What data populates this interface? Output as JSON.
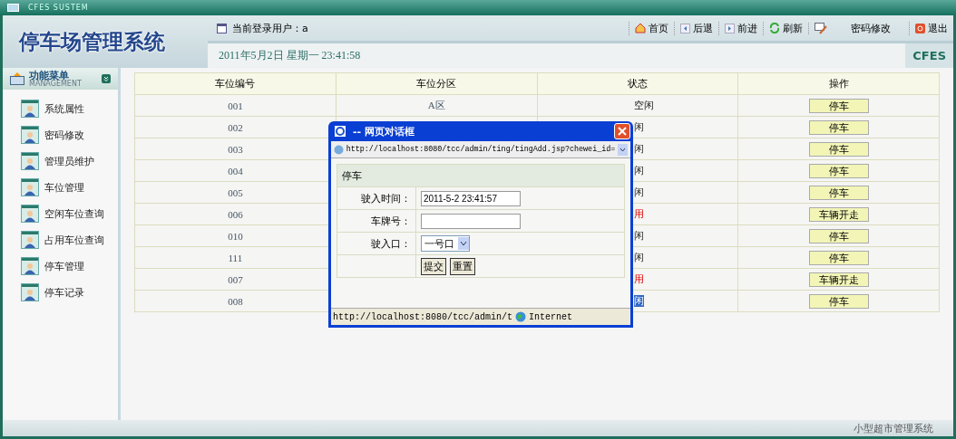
{
  "window": {
    "title": "CFES SUSTEM"
  },
  "header": {
    "app_title": "停车场管理系统",
    "user_label": "当前登录用户：a",
    "datetime": "2011年5月2日  星期一  23:41:58",
    "brand": "CFES",
    "toolbar": [
      {
        "kind": "home",
        "label": "首页"
      },
      {
        "kind": "back",
        "label": "后退"
      },
      {
        "kind": "forward",
        "label": "前进"
      },
      {
        "kind": "refresh",
        "label": "刷新"
      },
      {
        "kind": "edit"
      },
      {
        "kind": "text",
        "label": "密码修改"
      },
      {
        "kind": "exit",
        "label": "退出"
      }
    ]
  },
  "sidebar": {
    "title": "功能菜单",
    "subtitle": "MANAGEMENT",
    "items": [
      "系统属性",
      "密码修改",
      "管理员维护",
      "车位管理",
      "空闲车位查询",
      "占用车位查询",
      "停车管理",
      "停车记录"
    ]
  },
  "table": {
    "columns": [
      "车位编号",
      "车位分区",
      "状态",
      "操作"
    ],
    "rows": [
      {
        "number": "001",
        "zone": "A区",
        "status": "空闲",
        "in_use": false,
        "selected": false,
        "action": "停车"
      },
      {
        "number": "002",
        "status": "闲",
        "in_use": false,
        "selected": false,
        "action": "停车"
      },
      {
        "number": "003",
        "status": "闲",
        "in_use": false,
        "selected": false,
        "action": "停车"
      },
      {
        "number": "004",
        "status": "闲",
        "in_use": false,
        "selected": false,
        "action": "停车"
      },
      {
        "number": "005",
        "status": "闲",
        "in_use": false,
        "selected": false,
        "action": "停车"
      },
      {
        "number": "006",
        "status": "用",
        "in_use": true,
        "selected": false,
        "action": "车辆开走"
      },
      {
        "number": "010",
        "status": "闲",
        "in_use": false,
        "selected": false,
        "action": "停车"
      },
      {
        "number": "111",
        "status": "闲",
        "in_use": false,
        "selected": false,
        "action": "停车"
      },
      {
        "number": "007",
        "status": "用",
        "in_use": true,
        "selected": false,
        "action": "车辆开走"
      },
      {
        "number": "008",
        "status": "闲",
        "in_use": false,
        "selected": true,
        "action": "停车"
      }
    ]
  },
  "dialog": {
    "title": "-- 网页对话框",
    "url": "http://localhost:8080/tcc/admin/ting/tingAdd.jsp?chewei_id=",
    "section": "停车",
    "fields": [
      {
        "label": "驶入时间：",
        "kind": "text",
        "value": "2011-5-2 23:41:57"
      },
      {
        "label": "车牌号：",
        "kind": "text"
      },
      {
        "label": "驶入口：",
        "kind": "select",
        "value": "一号口"
      }
    ],
    "buttons": [
      "提交",
      "重置"
    ],
    "status_url": "http://localhost:8080/tcc/admin/t",
    "zone": "Internet"
  },
  "status_bar": {
    "text": "小型超市管理系统"
  }
}
